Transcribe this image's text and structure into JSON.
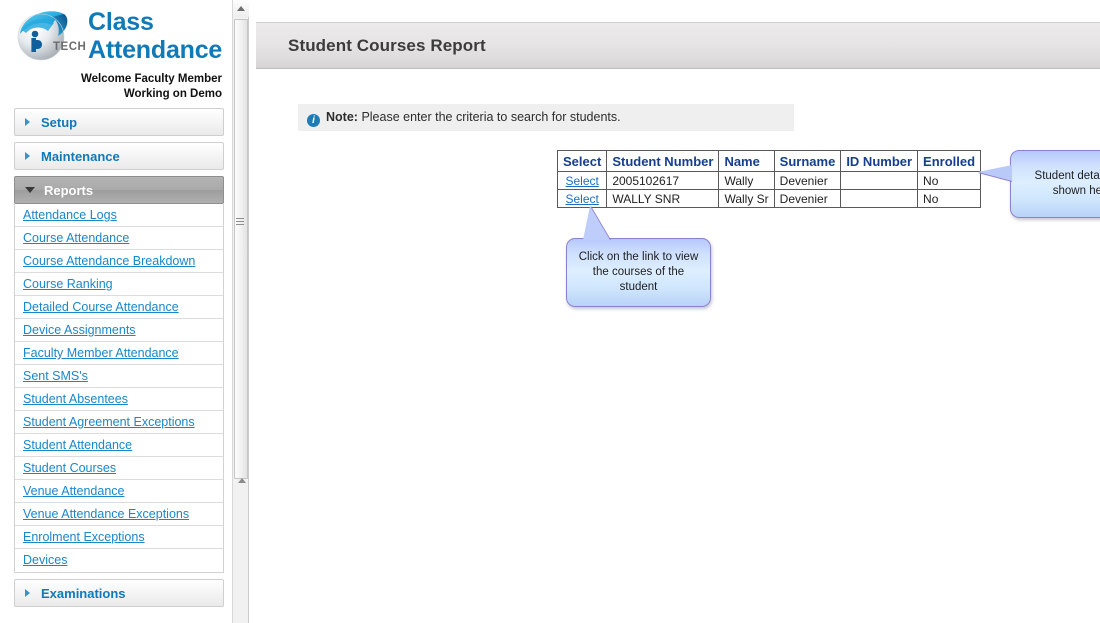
{
  "brand": {
    "logo_icon": "iptech-globe-logo",
    "title_line1": "Class",
    "title_line2": "Attendance",
    "welcome": "Welcome Faculty Member",
    "working_on": "Working on Demo"
  },
  "sidebar": {
    "sections": [
      {
        "label": "Setup",
        "expanded": false,
        "icon": "chevron-right-icon"
      },
      {
        "label": "Maintenance",
        "expanded": false,
        "icon": "chevron-right-icon"
      },
      {
        "label": "Reports",
        "expanded": true,
        "icon": "chevron-down-icon"
      }
    ],
    "reports_links": [
      "Attendance Logs",
      "Course Attendance",
      "Course Attendance Breakdown",
      "Course Ranking",
      "Detailed Course Attendance",
      "Device Assignments",
      "Faculty Member Attendance",
      "Sent SMS's",
      "Student Absentees",
      "Student Agreement Exceptions",
      "Student Attendance",
      "Student Courses",
      "Venue Attendance",
      "Venue Attendance Exceptions",
      "Enrolment Exceptions",
      "Devices"
    ],
    "bottom_section": {
      "label": "Examinations",
      "expanded": false,
      "icon": "chevron-right-icon"
    },
    "scrollbar": {
      "up_icon": "scroll-up-arrow-icon",
      "down_icon": "scroll-down-arrow-icon",
      "grip_icon": "scrollbar-grip-icon"
    }
  },
  "main": {
    "page_title": "Student Courses Report",
    "note": {
      "icon": "info-icon",
      "prefix": "Note:",
      "text": "Please enter the criteria to search for students."
    },
    "table": {
      "headers": [
        "Select",
        "Student Number",
        "Name",
        "Surname",
        "ID Number",
        "Enrolled"
      ],
      "rows": [
        {
          "select": "Select",
          "student_number": "2005102617",
          "name": "Wally",
          "surname": "Devenier",
          "id_number": "",
          "enrolled": "No"
        },
        {
          "select": "Select",
          "student_number": "WALLY SNR",
          "name": "Wally Sr",
          "surname": "Devenier",
          "id_number": "",
          "enrolled": "No"
        }
      ]
    },
    "callouts": [
      {
        "id": "details",
        "text": "Student details are shown here"
      },
      {
        "id": "click",
        "text": "Click on the link to view the courses of the student"
      }
    ]
  },
  "colors": {
    "brand_blue": "#1079b8",
    "link_blue": "#1a87c9",
    "header_gray": "#e6e4e4",
    "active_section_gray": "#a9a9a9",
    "callout_border": "#8f7fd0",
    "table_header_blue": "#153f8c"
  }
}
